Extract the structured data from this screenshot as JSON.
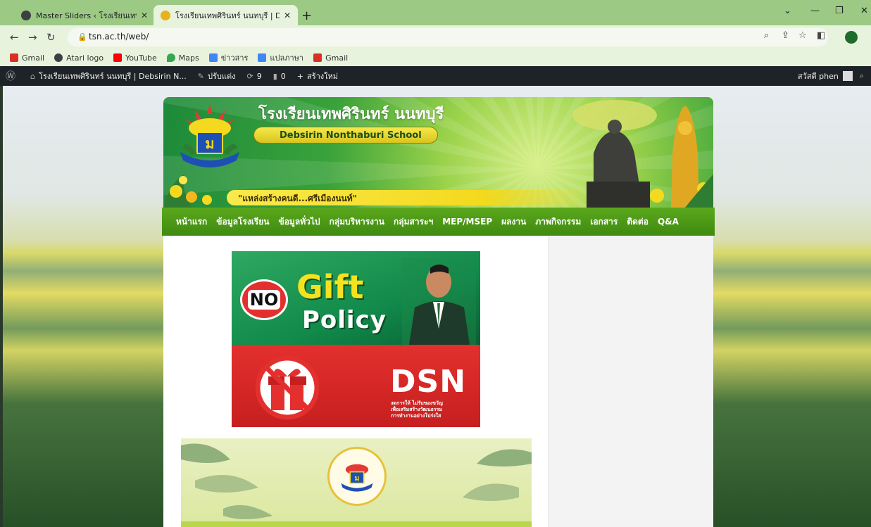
{
  "browser": {
    "tabs": [
      {
        "title": "Master Sliders ‹ โรงเรียนเทพศิรินทร์",
        "active": false
      },
      {
        "title": "โรงเรียนเทพศิรินทร์ นนทบุรี | Debsirin",
        "active": true
      }
    ],
    "new_tab": "+",
    "url": "tsn.ac.th/web/",
    "bookmarks": [
      {
        "label": "Gmail",
        "icon": "gmail-icon",
        "color": "#d93025"
      },
      {
        "label": "Atari logo",
        "icon": "globe-icon",
        "color": "#3c4043"
      },
      {
        "label": "YouTube",
        "icon": "youtube-icon",
        "color": "#ff0000"
      },
      {
        "label": "Maps",
        "icon": "maps-icon",
        "color": "#34a853"
      },
      {
        "label": "ข่าวสาร",
        "icon": "news-icon",
        "color": "#4285f4"
      },
      {
        "label": "แปลภาษา",
        "icon": "translate-icon",
        "color": "#4285f4"
      },
      {
        "label": "Gmail",
        "icon": "gmail-icon",
        "color": "#d93025"
      }
    ]
  },
  "adminbar": {
    "site_name": "โรงเรียนเทพศิรินทร์ นนทบุรี | Debsirin N...",
    "customize": "ปรับแต่ง",
    "updates": "9",
    "comments": "0",
    "new": "สร้างใหม่",
    "greeting": "สวัสดี phen"
  },
  "header": {
    "school_name_th": "โรงเรียนเทพศิรินทร์ นนทบุรี",
    "school_name_en": "Debsirin Nonthaburi School",
    "slogan": "\"แหล่งสร้างคนดี...ศรีเมืองนนท์\""
  },
  "menu": [
    "หน้าแรก",
    "ข้อมูลโรงเรียน",
    "ข้อมูลทั่วไป",
    "กลุ่มบริหารงาน",
    "กลุ่มสาระฯ",
    "MEP/MSEP",
    "ผลงาน",
    "ภาพกิจกรรม",
    "เอกสาร",
    "ติดต่อ",
    "Q&A"
  ],
  "poster": {
    "no": "NO",
    "gift": "Gift",
    "policy": "Policy",
    "dsn": "DSN",
    "dsn_sub": [
      "งดการให้ ไม่รับของขวัญ",
      "เพื่อเสริมสร้างวัฒนธรรม",
      "การทำงานอย่างโปร่งใส"
    ]
  },
  "colors": {
    "tab_bg": "#9cc983",
    "toolbar_bg": "#e8f3de",
    "adminbar_bg": "#1d2327",
    "menu_green": "#4e9a16",
    "banner_yellow": "#f4d91e"
  }
}
